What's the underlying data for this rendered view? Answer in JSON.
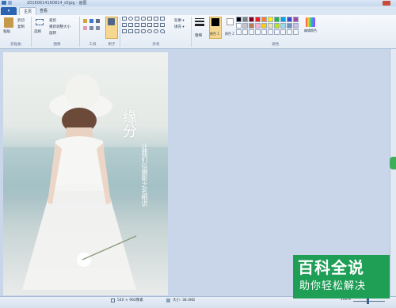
{
  "window": {
    "title": "20160614160814_s5jpg - 画图"
  },
  "tabs": {
    "file": "▾",
    "home": "主页",
    "view": "查看"
  },
  "ribbon": {
    "clipboard": {
      "paste": "粘贴",
      "cut": "剪切",
      "copy": "复制",
      "label": "剪贴板"
    },
    "image": {
      "select": "选择",
      "crop": "裁剪",
      "resize": "重新调整大小",
      "rotate": "旋转",
      "label": "图像"
    },
    "tools": {
      "label": "工具"
    },
    "brushes": {
      "label": "刷子"
    },
    "shapes": {
      "outline": "轮廓 ▾",
      "fill": "填充 ▾",
      "label": "形状"
    },
    "size": {
      "label": "粗细"
    },
    "color1": {
      "label": "颜色 1"
    },
    "color2": {
      "label": "颜色 2"
    },
    "colors": {
      "label": "颜色",
      "edit": "编辑颜色"
    },
    "palette": [
      "#000000",
      "#7f7f7f",
      "#880015",
      "#ed1c24",
      "#ff7f27",
      "#fff200",
      "#22b14c",
      "#00a2e8",
      "#3f48cc",
      "#a349a4",
      "#ffffff",
      "#c3c3c3",
      "#b97a57",
      "#ffaec9",
      "#ffc90e",
      "#efe4b0",
      "#b5e61d",
      "#99d9ea",
      "#7092be",
      "#c8bfe7"
    ]
  },
  "photo": {
    "calligraphy_title": "缘分",
    "calligraphy_subtitle": "让我们以摄影之名相识"
  },
  "status": {
    "dimensions": "540 × 960像素",
    "filesize": "大小: 38.0KB",
    "zoom": "100%"
  },
  "watermark": {
    "line1": "百科全说",
    "line2": "助你轻松解决"
  },
  "colors": {
    "accent": "#2a63b0",
    "watermark_bg": "#1f9e56"
  }
}
